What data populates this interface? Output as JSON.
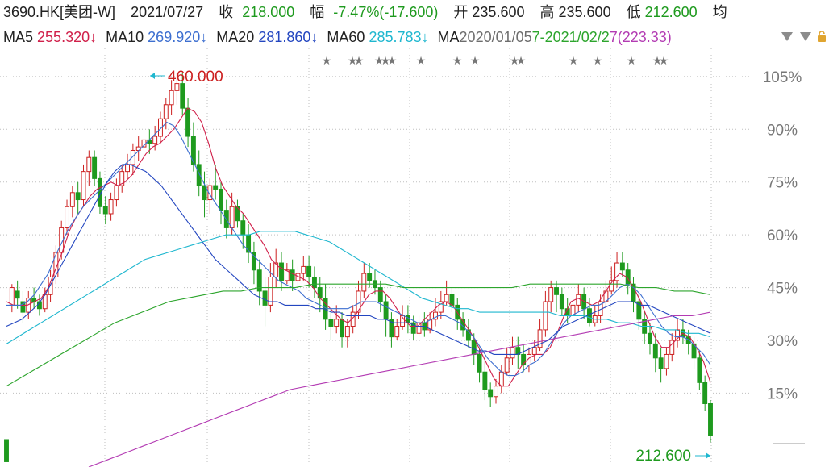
{
  "header": {
    "code": "3690.HK[美团-W]",
    "date": "2021/07/27",
    "close_label": "收",
    "close_value": "218.000",
    "change_label": "幅",
    "change_value": "-7.47%(-17.600)",
    "open_label": "开",
    "open_value": "235.600",
    "high_label": "高",
    "high_value": "235.600",
    "low_label": "低",
    "low_value": "212.600",
    "avg_label": "均"
  },
  "ma_row": {
    "ma5_label": "MA5",
    "ma5_value": "255.320↓",
    "ma10_label": "MA10",
    "ma10_value": "269.920↓",
    "ma20_label": "MA20",
    "ma20_value": "281.860↓",
    "ma60_label": "MA60",
    "ma60_value": "285.783↓",
    "overlap_text_1": "MA",
    "overlap_text_2": "2020/01/05",
    "overlap_text_3": "7-2021/02/2",
    "overlap_text_4": "7(223.33)"
  },
  "colors": {
    "up": "#cc1f1f",
    "down": "#1e9a1e",
    "ma5": "#d0204a",
    "ma10": "#3d6fd0",
    "ma20": "#2346c0",
    "ma60": "#1fb7cf",
    "ma_long_green": "#2da52d",
    "ma_long_purple": "#b33bb3",
    "grid": "#bfbfbf",
    "star": "#777777"
  },
  "chart_data": {
    "type": "candlestick",
    "y_axis_label_format": "percent",
    "y_ticks": [
      "105%",
      "90%",
      "75%",
      "60%",
      "45%",
      "30%",
      "15%"
    ],
    "y_tick_values": [
      105,
      90,
      75,
      60,
      45,
      30,
      15
    ],
    "ylim": [
      -6,
      113
    ],
    "grid": true,
    "max_annotation": "460.000",
    "min_annotation": "212.600",
    "star_markers": 15,
    "candles": [
      [
        1.8,
        -4.5,
        1.8,
        -4.5
      ],
      [
        40,
        45,
        46,
        38
      ],
      [
        44,
        42,
        47,
        39
      ],
      [
        41,
        38,
        44,
        35
      ],
      [
        38,
        42,
        44,
        36
      ],
      [
        42,
        41,
        45,
        39
      ],
      [
        41,
        39,
        43,
        37
      ],
      [
        39,
        43,
        45,
        38
      ],
      [
        43,
        48,
        50,
        41
      ],
      [
        48,
        55,
        57,
        46
      ],
      [
        55,
        62,
        64,
        53
      ],
      [
        62,
        68,
        70,
        60
      ],
      [
        68,
        72,
        74,
        65
      ],
      [
        72,
        70,
        75,
        66
      ],
      [
        70,
        78,
        80,
        68
      ],
      [
        78,
        82,
        84,
        74
      ],
      [
        82,
        76,
        84,
        74
      ],
      [
        76,
        68,
        78,
        66
      ],
      [
        68,
        66,
        71,
        63
      ],
      [
        66,
        70,
        72,
        64
      ],
      [
        70,
        74,
        76,
        68
      ],
      [
        74,
        78,
        80,
        72
      ],
      [
        78,
        80,
        83,
        76
      ],
      [
        80,
        84,
        86,
        77
      ],
      [
        84,
        85,
        88,
        81
      ],
      [
        85,
        87,
        89,
        82
      ],
      [
        87,
        86,
        90,
        83
      ],
      [
        86,
        88,
        91,
        84
      ],
      [
        88,
        93,
        95,
        86
      ],
      [
        93,
        97,
        99,
        90
      ],
      [
        97,
        101,
        104,
        94
      ],
      [
        101,
        103,
        106,
        97
      ],
      [
        103,
        96,
        106,
        94
      ],
      [
        96,
        88,
        99,
        85
      ],
      [
        88,
        80,
        92,
        78
      ],
      [
        80,
        74,
        84,
        71
      ],
      [
        74,
        70,
        78,
        65
      ],
      [
        70,
        74,
        76,
        66
      ],
      [
        74,
        73,
        80,
        70
      ],
      [
        73,
        67,
        75,
        63
      ],
      [
        67,
        62,
        70,
        59
      ],
      [
        62,
        68,
        72,
        60
      ],
      [
        68,
        64,
        70,
        62
      ],
      [
        64,
        60,
        66,
        56
      ],
      [
        60,
        55,
        63,
        52
      ],
      [
        55,
        50,
        58,
        46
      ],
      [
        50,
        44,
        53,
        40
      ],
      [
        44,
        40,
        48,
        34
      ],
      [
        40,
        48,
        52,
        38
      ],
      [
        48,
        52,
        56,
        45
      ],
      [
        52,
        47,
        55,
        44
      ],
      [
        47,
        50,
        52,
        46
      ],
      [
        50,
        47,
        53,
        44
      ],
      [
        47,
        49,
        51,
        45
      ],
      [
        49,
        51,
        54,
        47
      ],
      [
        51,
        48,
        54,
        45
      ],
      [
        48,
        45,
        51,
        42
      ],
      [
        45,
        42,
        48,
        38
      ],
      [
        42,
        36,
        46,
        33
      ],
      [
        36,
        34,
        39,
        30
      ],
      [
        34,
        36,
        40,
        32
      ],
      [
        36,
        31,
        38,
        28
      ],
      [
        31,
        34,
        36,
        28
      ],
      [
        34,
        38,
        40,
        32
      ],
      [
        38,
        44,
        47,
        36
      ],
      [
        44,
        49,
        52,
        42
      ],
      [
        49,
        47,
        52,
        45
      ],
      [
        47,
        45,
        50,
        43
      ],
      [
        45,
        41,
        47,
        38
      ],
      [
        41,
        36,
        43,
        31
      ],
      [
        36,
        31,
        38,
        28
      ],
      [
        31,
        34,
        36,
        30
      ],
      [
        34,
        37,
        40,
        33
      ],
      [
        37,
        35,
        40,
        32
      ],
      [
        35,
        32,
        37,
        30
      ],
      [
        32,
        35,
        37,
        31
      ],
      [
        35,
        33,
        38,
        31
      ],
      [
        33,
        36,
        38,
        32
      ],
      [
        36,
        38,
        42,
        34
      ],
      [
        38,
        41,
        44,
        36
      ],
      [
        41,
        43,
        47,
        40
      ],
      [
        43,
        40,
        45,
        38
      ],
      [
        40,
        36,
        42,
        33
      ],
      [
        36,
        33,
        38,
        31
      ],
      [
        33,
        30,
        36,
        28
      ],
      [
        30,
        26,
        32,
        23
      ],
      [
        26,
        21,
        28,
        18
      ],
      [
        21,
        16,
        24,
        13
      ],
      [
        16,
        14,
        18,
        11
      ],
      [
        14,
        17,
        19,
        12
      ],
      [
        17,
        21,
        23,
        15
      ],
      [
        21,
        25,
        28,
        20
      ],
      [
        25,
        28,
        31,
        23
      ],
      [
        28,
        26,
        31,
        22
      ],
      [
        26,
        23,
        29,
        21
      ],
      [
        23,
        26,
        28,
        21
      ],
      [
        26,
        28,
        30,
        24
      ],
      [
        28,
        33,
        36,
        27
      ],
      [
        33,
        41,
        44,
        31
      ],
      [
        41,
        45,
        47,
        38
      ],
      [
        45,
        43,
        47,
        38
      ],
      [
        43,
        39,
        45,
        37
      ],
      [
        39,
        37,
        42,
        35
      ],
      [
        37,
        40,
        42,
        35
      ],
      [
        40,
        43,
        46,
        38
      ],
      [
        43,
        39,
        45,
        36
      ],
      [
        39,
        35,
        42,
        34
      ],
      [
        35,
        37,
        40,
        34
      ],
      [
        37,
        41,
        43,
        35
      ],
      [
        41,
        44,
        47,
        39
      ],
      [
        44,
        47,
        51,
        43
      ],
      [
        47,
        52,
        55,
        45
      ],
      [
        52,
        50,
        55,
        48
      ],
      [
        50,
        46,
        52,
        43
      ],
      [
        46,
        41,
        48,
        38
      ],
      [
        41,
        36,
        43,
        33
      ],
      [
        36,
        32,
        38,
        29
      ],
      [
        32,
        29,
        35,
        26
      ],
      [
        29,
        25,
        32,
        21
      ],
      [
        25,
        22,
        28,
        18
      ],
      [
        22,
        26,
        28,
        20
      ],
      [
        26,
        30,
        32,
        24
      ],
      [
        30,
        33,
        36,
        28
      ],
      [
        33,
        31,
        36,
        29
      ],
      [
        31,
        29,
        33,
        26
      ],
      [
        29,
        25,
        31,
        22
      ],
      [
        25,
        18,
        27,
        16
      ],
      [
        18,
        12,
        20,
        10
      ],
      [
        12,
        3,
        13,
        1
      ]
    ],
    "moving_averages": [
      {
        "name": "MA5",
        "values": [
          41,
          40,
          40,
          40,
          41,
          42,
          45,
          50,
          55,
          61,
          65,
          68,
          71,
          73,
          74,
          75,
          74,
          75,
          77,
          80,
          83,
          85,
          86,
          88,
          90,
          93,
          96,
          95,
          92,
          86,
          79,
          74,
          71,
          68,
          66,
          63,
          60,
          57,
          53,
          51,
          50,
          49,
          48,
          47,
          45,
          42,
          40,
          38,
          36,
          35,
          37,
          40,
          43,
          44,
          44,
          42,
          39,
          36,
          34,
          34,
          36,
          38,
          40,
          41,
          40,
          37,
          34,
          31,
          27,
          23,
          19,
          17,
          17,
          20,
          23,
          25,
          26,
          26,
          28,
          32,
          37,
          41,
          42,
          41,
          40,
          41,
          44,
          47,
          49,
          48,
          45,
          41,
          36,
          31,
          28,
          28,
          30,
          32,
          31,
          28,
          24,
          18
        ]
      },
      {
        "name": "MA10",
        "values": [
          40,
          40,
          40,
          41,
          43,
          46,
          49,
          54,
          58,
          62,
          65,
          68,
          70,
          72,
          74,
          76,
          78,
          80,
          82,
          84,
          86,
          88,
          90,
          92,
          91,
          88,
          84,
          80,
          76,
          72,
          69,
          66,
          63,
          60,
          57,
          55,
          53,
          51,
          49,
          47,
          46,
          45,
          44,
          42,
          41,
          40,
          39,
          39,
          39,
          39,
          40,
          41,
          41,
          41,
          40,
          39,
          38,
          37,
          36,
          35,
          35,
          36,
          37,
          37,
          36,
          35,
          33,
          31,
          28,
          25,
          23,
          21,
          20,
          20,
          21,
          23,
          24,
          26,
          29,
          32,
          35,
          37,
          38,
          39,
          40,
          40,
          41,
          43,
          45,
          46,
          45,
          43,
          40,
          37,
          34,
          32,
          31,
          31,
          30,
          28,
          26,
          23
        ]
      },
      {
        "name": "MA20",
        "values": [
          34,
          35,
          36,
          38,
          40,
          43,
          47,
          51,
          55,
          59,
          63,
          67,
          71,
          75,
          78,
          80,
          80,
          79,
          78,
          76,
          74,
          71,
          68,
          65,
          62,
          59,
          56,
          53,
          51,
          49,
          47,
          45,
          43,
          42,
          41,
          41,
          40,
          40,
          40,
          40,
          39,
          39,
          38,
          38,
          37,
          37,
          37,
          37,
          36,
          36,
          35,
          35,
          35,
          34,
          34,
          33,
          32,
          31,
          30,
          29,
          28,
          27,
          27,
          26,
          26,
          26,
          26,
          27,
          28,
          29,
          30,
          32,
          34,
          35,
          36,
          37,
          38,
          39,
          40,
          41,
          41,
          41,
          40,
          40,
          39,
          38,
          37,
          36,
          35,
          34,
          33,
          32
        ]
      },
      {
        "name": "MA60",
        "values": [
          29,
          31,
          33,
          35,
          37,
          39,
          41,
          43,
          45,
          47,
          49,
          51,
          53,
          54,
          55,
          56,
          57,
          58,
          59,
          60,
          60,
          60,
          61,
          61,
          61,
          61,
          60,
          59,
          58,
          56,
          54,
          52,
          50,
          48,
          46,
          44,
          42,
          41,
          40,
          39,
          39,
          38,
          38,
          38,
          38,
          38,
          38,
          38,
          37,
          37,
          37,
          36,
          36,
          35,
          35,
          34,
          34,
          33,
          33,
          32,
          32,
          31
        ]
      },
      {
        "name": "MA_green",
        "values": [
          17,
          20,
          23,
          26,
          29,
          32,
          35,
          37,
          39,
          41,
          42,
          43,
          44,
          44,
          45,
          45,
          45,
          46,
          46,
          46,
          46,
          46,
          45,
          45,
          45,
          45,
          45,
          45,
          45,
          46,
          46,
          46,
          46,
          46,
          46,
          45,
          45,
          44,
          44,
          43
        ]
      },
      {
        "name": "MA_purple",
        "values": [
          -6,
          -4,
          -2,
          0,
          2,
          4,
          6,
          8,
          10,
          12,
          14,
          16,
          17,
          18,
          19,
          20,
          21,
          22,
          23,
          24,
          25,
          26,
          27,
          28,
          29,
          30,
          31,
          32,
          33,
          34,
          35,
          36,
          37,
          37,
          38
        ]
      }
    ]
  }
}
